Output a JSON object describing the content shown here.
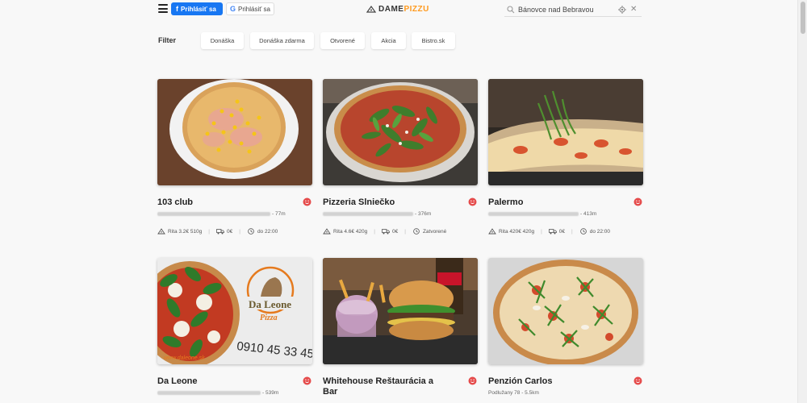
{
  "header": {
    "facebook_login_label": "Prihlásiť sa",
    "google_login_label": "Prihlásiť sa",
    "logo_part1": "DAME",
    "logo_part2": "PIZZU",
    "search_value": "Bánovce nad Bebravou"
  },
  "filters": {
    "label": "Filter",
    "chips": [
      "Donáška",
      "Donáška zdarma",
      "Otvorené",
      "Akcia",
      "Bistro.sk"
    ]
  },
  "restaurants": [
    {
      "name": "103 club",
      "distance": "- 77m",
      "price": "Rita 3.2€ 510g",
      "delivery": "0€",
      "hours": "do 22:00"
    },
    {
      "name": "Pizzeria Slniečko",
      "distance": "- 376m",
      "price": "Rita 4.6€ 420g",
      "delivery": "0€",
      "hours": "Zatvorené"
    },
    {
      "name": "Palermo",
      "distance": "- 413m",
      "price": "Rita 420€ 420g",
      "delivery": "0€",
      "hours": "do 22:00"
    },
    {
      "name": "Da Leone",
      "distance": "- 539m"
    },
    {
      "name": "Whitehouse Reštaurácia a Bar"
    },
    {
      "name": "Penzión Carlos",
      "address": "Podlužany 78 - 5.5km"
    }
  ],
  "colors": {
    "facebook_blue": "#1877f2",
    "logo_orange": "#ff9a1e",
    "favorite_red": "#e54b4b"
  },
  "icons": [
    "menu-icon",
    "facebook-icon",
    "google-icon",
    "pizza-logo-icon",
    "search-icon",
    "locate-icon",
    "close-icon",
    "favorite-icon",
    "pizza-icon",
    "delivery-truck-icon",
    "clock-icon"
  ]
}
